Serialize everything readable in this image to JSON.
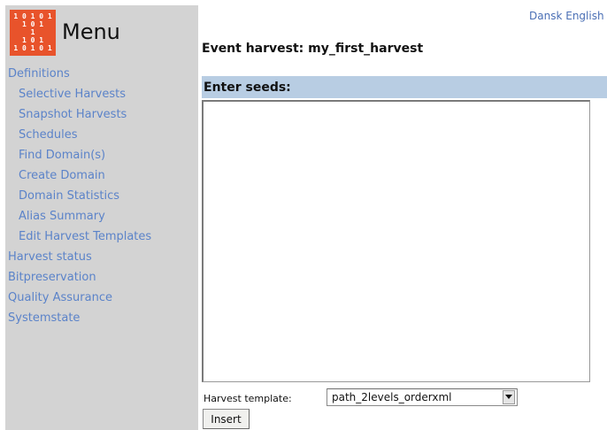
{
  "sidebar": {
    "logo_bits": [
      "1 0 1 0 1",
      "1 0 1",
      "1",
      "1 0 1",
      "1 0 1 0 1"
    ],
    "logo_color": "#e8532b",
    "menu_title": "Menu",
    "items": [
      {
        "label": "Definitions",
        "level": 1
      },
      {
        "label": "Selective Harvests",
        "level": 2
      },
      {
        "label": "Snapshot Harvests",
        "level": 2
      },
      {
        "label": "Schedules",
        "level": 2
      },
      {
        "label": "Find Domain(s)",
        "level": 2
      },
      {
        "label": "Create Domain",
        "level": 2
      },
      {
        "label": "Domain Statistics",
        "level": 2
      },
      {
        "label": "Alias Summary",
        "level": 2
      },
      {
        "label": "Edit Harvest Templates",
        "level": 2
      },
      {
        "label": "Harvest status",
        "level": 1
      },
      {
        "label": "Bitpreservation",
        "level": 1
      },
      {
        "label": "Quality Assurance",
        "level": 1
      },
      {
        "label": "Systemstate",
        "level": 1
      }
    ]
  },
  "header": {
    "lang_dansk": "Dansk",
    "lang_english": "English"
  },
  "main": {
    "title": "Event harvest: my_first_harvest",
    "seeds_heading": "Enter seeds:",
    "seeds_value": "",
    "template_label": "Harvest template:",
    "template_selected": "path_2levels_orderxml",
    "insert_label": "Insert"
  },
  "colors": {
    "sidebar_bg": "#d3d3d3",
    "link": "#5b83c9",
    "section_bar": "#b8cde3"
  }
}
